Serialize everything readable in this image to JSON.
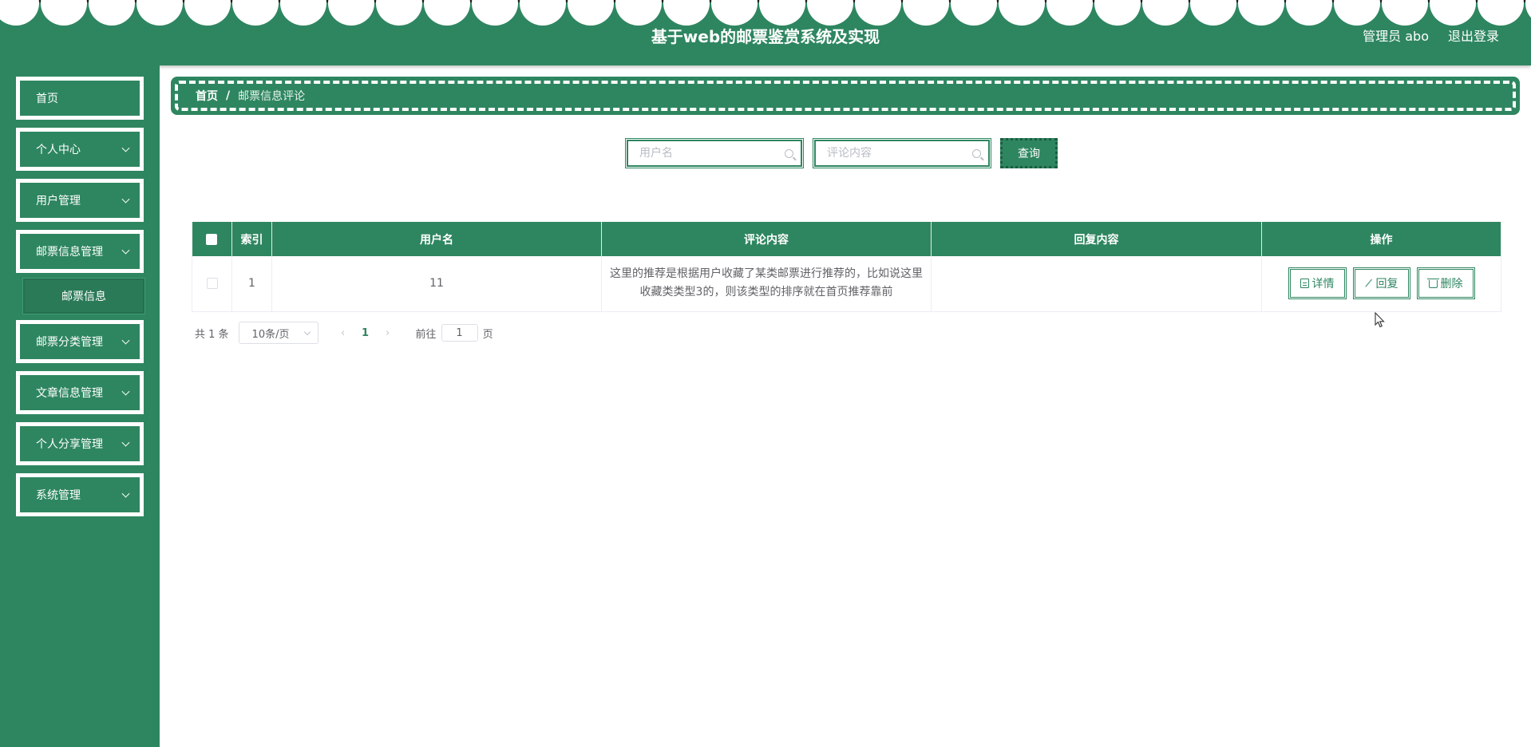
{
  "header": {
    "title": "基于web的邮票鉴赏系统及实现",
    "user": "管理员 abo",
    "logout": "退出登录"
  },
  "sidebar": {
    "items": [
      {
        "label": "首页"
      },
      {
        "label": "个人中心"
      },
      {
        "label": "用户管理"
      },
      {
        "label": "邮票信息管理"
      },
      {
        "label": "邮票分类管理"
      },
      {
        "label": "文章信息管理"
      },
      {
        "label": "个人分享管理"
      },
      {
        "label": "系统管理"
      }
    ],
    "submenu": {
      "label": "邮票信息"
    }
  },
  "breadcrumb": {
    "home": "首页",
    "separator": "/",
    "current": "邮票信息评论"
  },
  "search": {
    "username_placeholder": "用户名",
    "comment_placeholder": "评论内容",
    "query_label": "查询"
  },
  "table": {
    "headers": {
      "index": "索引",
      "username": "用户名",
      "comment": "评论内容",
      "reply": "回复内容",
      "actions": "操作"
    },
    "rows": [
      {
        "index": "1",
        "username": "11",
        "comment": "这里的推荐是根据用户收藏了某类邮票进行推荐的，比如说这里收藏类类型3的，则该类型的排序就在首页推荐靠前",
        "reply": ""
      }
    ],
    "actions": {
      "detail": "详情",
      "reply": "回复",
      "delete": "删除"
    }
  },
  "pagination": {
    "total": "共 1 条",
    "page_size": "10条/页",
    "current_page": "1",
    "goto_prefix": "前往",
    "goto_value": "1",
    "goto_suffix": "页"
  },
  "colors": {
    "primary": "#2e8660",
    "text": "#606266"
  }
}
